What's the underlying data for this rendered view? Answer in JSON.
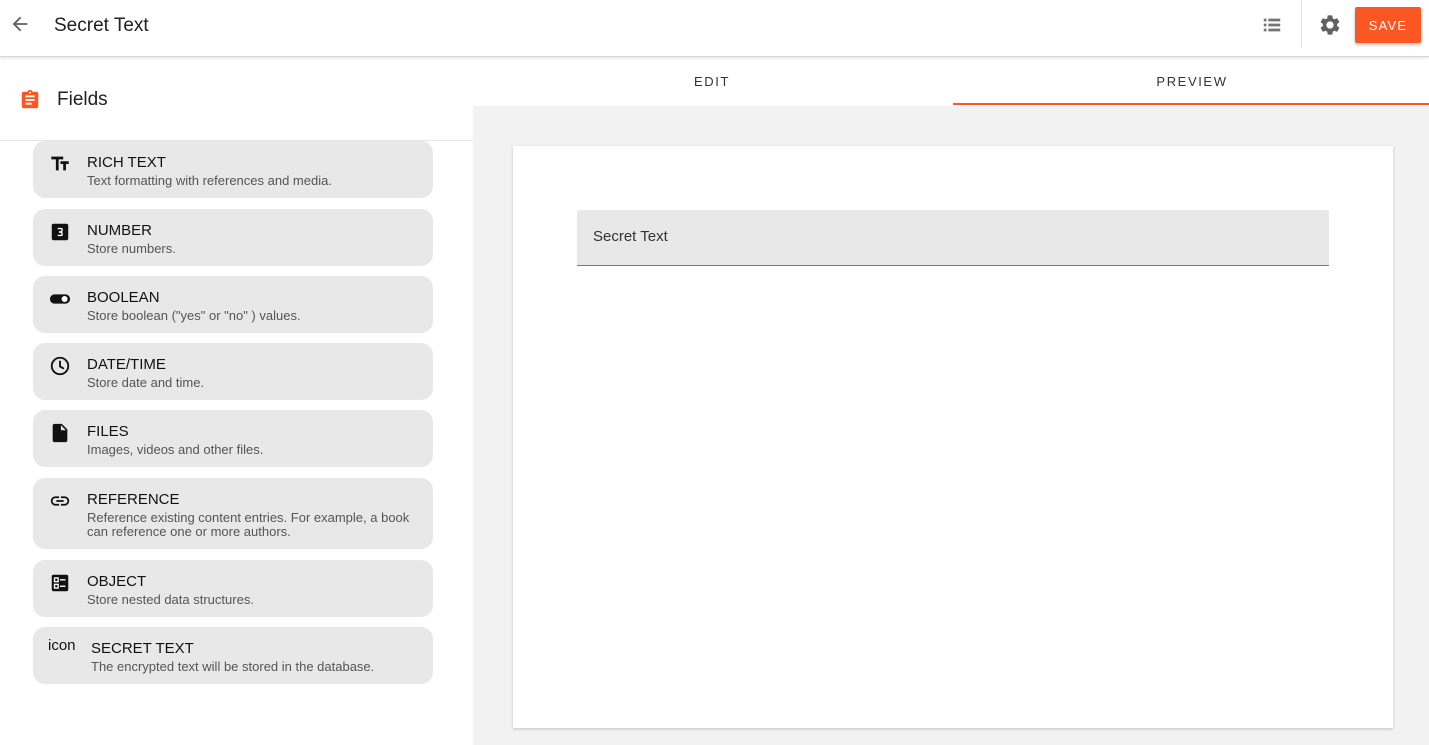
{
  "app_bar": {
    "title": "Secret Text",
    "save_label": "SAVE"
  },
  "icons": {
    "back": "arrow-left-icon",
    "list": "list-icon",
    "settings": "gear-icon",
    "fields": "clipboard-icon"
  },
  "colors": {
    "accent": "#fa5723",
    "card": "#e8e8e8",
    "canvas": "#f2f2f2"
  },
  "sidebar": {
    "title": "Fields",
    "fields": [
      {
        "name": "RICH TEXT",
        "description": "Text formatting with references and media.",
        "icon": "text-format-icon"
      },
      {
        "name": "NUMBER",
        "description": "Store numbers.",
        "icon": "number-3-icon"
      },
      {
        "name": "BOOLEAN",
        "description": "Store boolean (\"yes\" or \"no\" ) values.",
        "icon": "toggle-icon"
      },
      {
        "name": "DATE/TIME",
        "description": "Store date and time.",
        "icon": "clock-icon"
      },
      {
        "name": "FILES",
        "description": "Images, videos and other files.",
        "icon": "file-icon"
      },
      {
        "name": "REFERENCE",
        "description": "Reference existing content entries. For example, a book can reference one or more authors.",
        "icon": "link-icon"
      },
      {
        "name": "OBJECT",
        "description": "Store nested data structures.",
        "icon": "object-icon"
      },
      {
        "name": "SECRET TEXT",
        "description": "The encrypted text will be stored in the database.",
        "icon_text": "icon"
      }
    ]
  },
  "tabs": {
    "edit": "EDIT",
    "preview": "PREVIEW",
    "active": "PREVIEW"
  },
  "preview": {
    "field_label": "Secret Text"
  }
}
